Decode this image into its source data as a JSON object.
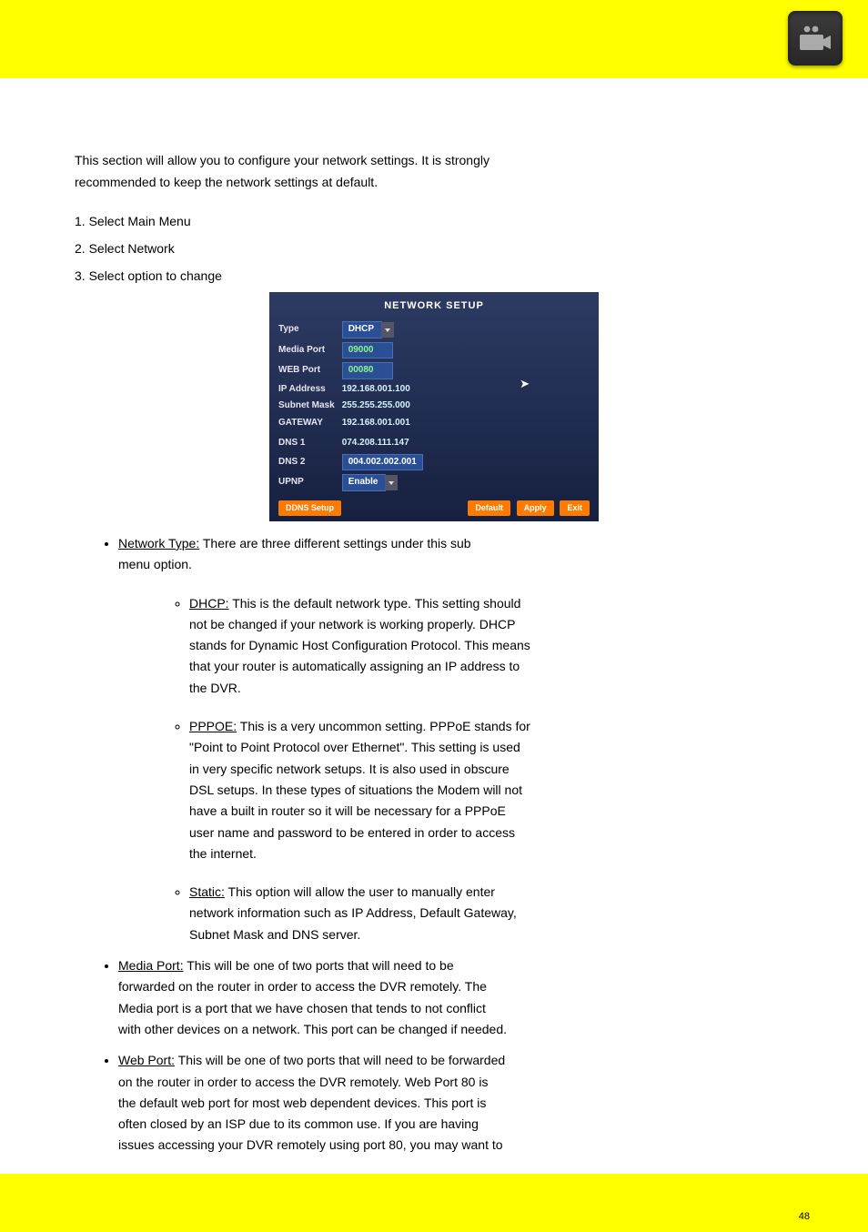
{
  "icon": "camera-icon",
  "intro": {
    "p1": "This section will allow you to configure your network settings. It is strongly",
    "p2": "recommended to keep the network settings at default."
  },
  "steps": {
    "s1": "1. Select Main Menu",
    "s2": "2. Select Network",
    "s3": "3. Select option to change"
  },
  "screenshot": {
    "title": "NETWORK  SETUP",
    "rows": {
      "type_label": "Type",
      "type_value": "DHCP",
      "media_label": "Media  Port",
      "media_value": "09000",
      "web_label": "WEB  Port",
      "web_value": "00080",
      "ip_label": "IP  Address",
      "ip_value": "192.168.001.100",
      "subnet_label": "Subnet  Mask",
      "subnet_value": "255.255.255.000",
      "gateway_label": "GATEWAY",
      "gateway_value": "192.168.001.001",
      "dns1_label": "DNS  1",
      "dns1_value": "074.208.111.147",
      "dns2_label": "DNS  2",
      "dns2_value": "004.002.002.001",
      "upnp_label": "UPNP",
      "upnp_value": "Enable"
    },
    "ddns_label": "DDNS  Setup",
    "btn_default": "Default",
    "btn_apply": "Apply",
    "btn_exit": "Exit"
  },
  "bullets": {
    "net_type": {
      "term": "Network Type:",
      "tail1": " There are three different settings under this sub",
      "p2": "menu option."
    },
    "dhcp": {
      "term": "DHCP:",
      "tail1": " This is the default network type. This setting should",
      "p2": "not be changed if your network is working properly. DHCP",
      "p3": "stands for Dynamic Host Configuration Protocol. This means",
      "p4": "that your router is automatically assigning an IP address to",
      "p5": "the DVR."
    },
    "pppoe": {
      "term": "PPPOE:",
      "tail1": " This is a very uncommon setting. PPPoE stands for",
      "p2": "\"Point to Point Protocol over Ethernet\". This setting is used",
      "p3": "in very specific network setups. It is also used in obscure",
      "p4": "DSL setups. In these types of situations the Modem will not",
      "p5": "have a built in router so it will be necessary for a PPPoE",
      "p6": "user name and password to be entered in order to access",
      "p7": "the internet."
    },
    "static": {
      "term": "Static:",
      "tail1": " This option will allow the user to manually enter",
      "p2": "network information such as IP Address, Default Gateway,",
      "p3": "Subnet Mask and DNS server."
    },
    "media_port": {
      "term": "Media Port:",
      "tail1": " This will be one of two ports that will need to be",
      "p2": "forwarded on the router in order to access the DVR remotely. The",
      "p3": "Media port is a port that we have chosen that tends to not conflict",
      "p4": "with other devices on a network. This port can be changed if needed."
    },
    "web_port": {
      "term": "Web Port:",
      "tail1": " This will be one of two ports that will need to be forwarded",
      "p2": "on the router in order to access the DVR remotely. Web Port 80 is",
      "p3": "the default web port for most web dependent devices. This port is",
      "p4": "often closed by an ISP due to its common use. If you are having",
      "p5": "issues accessing your DVR remotely using port 80, you may want to"
    }
  },
  "footer": "48"
}
